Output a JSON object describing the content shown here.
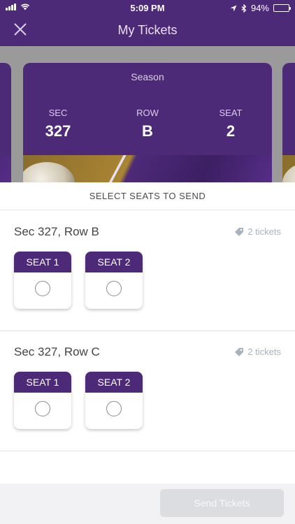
{
  "status": {
    "time": "5:09 PM",
    "battery": "94%",
    "battery_level": 0.94
  },
  "header": {
    "title": "My Tickets"
  },
  "ticket": {
    "season_label": "Season",
    "sec_label": "SEC",
    "sec_value": "327",
    "row_label": "ROW",
    "row_value": "B",
    "seat_label": "SEAT",
    "seat_value": "2"
  },
  "sheet": {
    "title": "SELECT SEATS TO SEND"
  },
  "groups": [
    {
      "title": "Sec 327, Row B",
      "count": "2 tickets",
      "seats": [
        "SEAT 1",
        "SEAT 2"
      ]
    },
    {
      "title": "Sec 327, Row C",
      "count": "2 tickets",
      "seats": [
        "SEAT 1",
        "SEAT 2"
      ]
    }
  ],
  "footer": {
    "send_label": "Send Tickets"
  },
  "colors": {
    "brand": "#4d2a78",
    "muted": "#a8b3bd",
    "button_disabled": "#dcdde0"
  },
  "icons": {
    "close": "close-icon",
    "tag": "tag-icon",
    "location": "location-arrow-icon",
    "bluetooth": "bluetooth-icon"
  }
}
